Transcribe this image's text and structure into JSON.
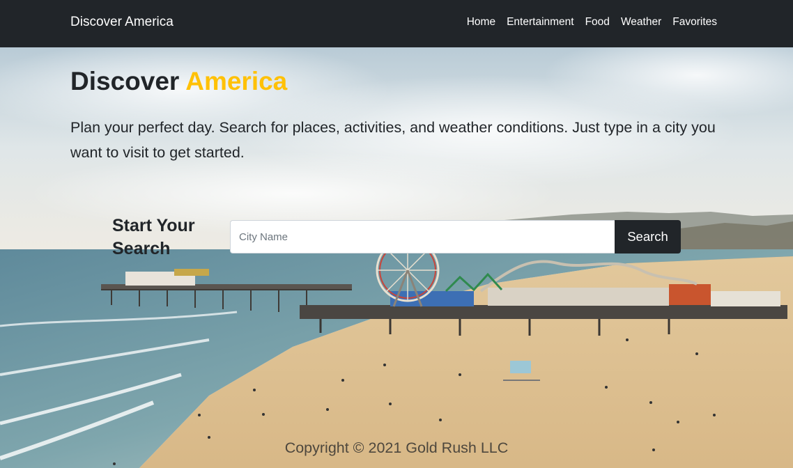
{
  "navbar": {
    "brand": "Discover America",
    "links": [
      "Home",
      "Entertainment",
      "Food",
      "Weather",
      "Favorites"
    ]
  },
  "hero": {
    "title_part1": "Discover ",
    "title_part2": "America",
    "lead": "Plan your perfect day. Search for places, activities, and weather conditions. Just type in a city you want to visit to get started."
  },
  "search": {
    "heading": "Start Your Search",
    "placeholder": "City Name",
    "button_label": "Search"
  },
  "footer": {
    "copyright": "Copyright © 2021 Gold Rush LLC"
  },
  "colors": {
    "navbar_bg": "#212529",
    "accent": "#ffc107",
    "text": "#212529"
  }
}
